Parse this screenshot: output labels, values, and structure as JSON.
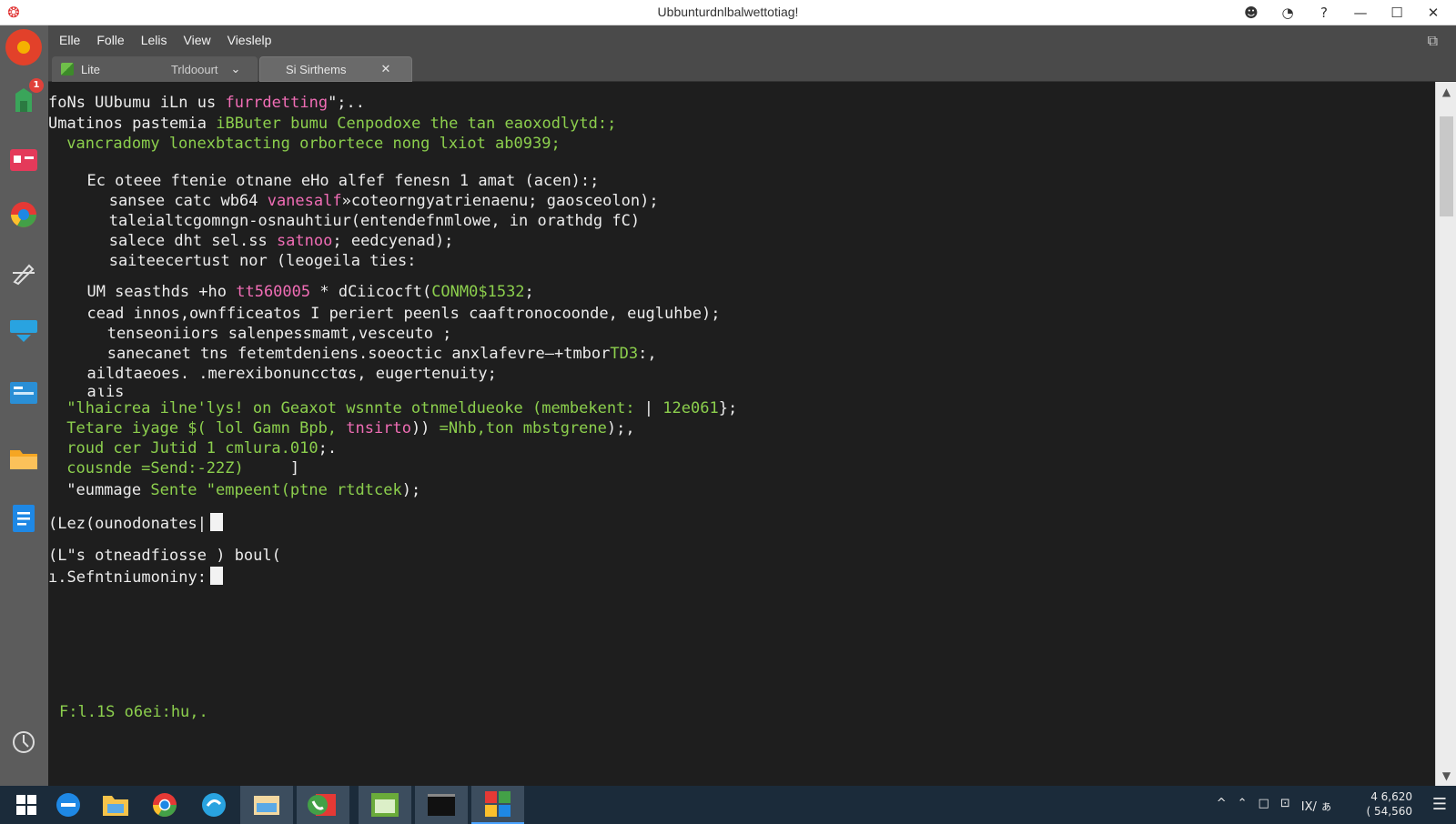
{
  "window": {
    "title": "Ubbunturdnlbalwettotiag!",
    "app_icon": "ubuntu-logo-icon"
  },
  "menu": [
    "Elle",
    "Folle",
    "Lelis",
    "View",
    "Vieslelp"
  ],
  "tabs": [
    {
      "label": "Lite",
      "sublabel": "Trldoourt",
      "icon": "cube-icon"
    },
    {
      "label": "Si Sirthems",
      "close": "✕"
    }
  ],
  "launcher": {
    "badge_count": "1"
  },
  "terminal": {
    "lines": [
      {
        "parts": [
          {
            "t": "foNs UUbumu iLn us ",
            "c": "w"
          },
          {
            "t": "furrdetting",
            "c": "p"
          },
          {
            "t": "\";..",
            "c": "w"
          }
        ]
      },
      {
        "parts": [
          {
            "t": "Umatinos pastemia ",
            "c": "w"
          },
          {
            "t": "iBButer bumu Cenpodoxe the tan eaoxodlytd:;",
            "c": "g"
          }
        ]
      },
      {
        "parts": [
          {
            "t": " vancradomy lonexbtacting orbortece nong lxiot ab0939;",
            "c": "g"
          }
        ]
      },
      {
        "parts": [
          {
            "t": "  Ec oteee ftenie otnane eHo alfef fenesn 1 amat (acen):;",
            "c": "w"
          }
        ]
      },
      {
        "parts": [
          {
            "t": "   sansee catc wb64 ",
            "c": "w"
          },
          {
            "t": "vanesalf",
            "c": "p"
          },
          {
            "t": "»coteorngyatrienaenu; gaosceolon);",
            "c": "w"
          }
        ]
      },
      {
        "parts": [
          {
            "t": "   taleialtcgomngn-osnauhtiur(entendefnmlowe, in orathdg fC)",
            "c": "w"
          }
        ]
      },
      {
        "parts": [
          {
            "t": "   salece dht sel.ss ",
            "c": "w"
          },
          {
            "t": "satnoo",
            "c": "p"
          },
          {
            "t": "; eedcyenad);",
            "c": "w"
          }
        ]
      },
      {
        "parts": [
          {
            "t": "   saiteecertust nor (leogeila ties:",
            "c": "w"
          }
        ]
      },
      {
        "parts": [
          {
            "t": "  UM seasthds +ho ",
            "c": "w"
          },
          {
            "t": "tt560005",
            "c": "p"
          },
          {
            "t": " * dCiicocft(",
            "c": "w"
          },
          {
            "t": "CONM0$1532",
            "c": "g"
          },
          {
            "t": ";",
            "c": "w"
          }
        ]
      },
      {
        "parts": [
          {
            "t": "  cead innos,ownfficeatos I periert peenls caaftronocoonde, eugluhbe);",
            "c": "w"
          }
        ]
      },
      {
        "parts": [
          {
            "t": "   tenseoniiors salenpessmamt,vesceuto ;",
            "c": "w"
          }
        ]
      },
      {
        "parts": [
          {
            "t": "   sanecanet tns fetemtdeniens.soeoctic anxlafevre—+tmbor",
            "c": "w"
          },
          {
            "t": "TD3",
            "c": "g"
          },
          {
            "t": ":,",
            "c": "w"
          }
        ]
      },
      {
        "parts": [
          {
            "t": "  aildtaeoes. .merexibonuncctαs, eugertenuity;",
            "c": "w"
          }
        ]
      },
      {
        "parts": [
          {
            "t": "  aιis",
            "c": "w"
          }
        ]
      },
      {
        "parts": [
          {
            "t": " \"lhaicrea ilne'lys! on Geaxot wsnnte otnmeldueoke (membekent:",
            "c": "g"
          },
          {
            "t": " | ",
            "c": "w"
          },
          {
            "t": "12e061",
            "c": "g"
          },
          {
            "t": "};",
            "c": "w"
          }
        ]
      },
      {
        "parts": [
          {
            "t": " Tetare iyage $( lol Gamn Bpb, ",
            "c": "g"
          },
          {
            "t": "tnsirto",
            "c": "p"
          },
          {
            "t": ")) ",
            "c": "w"
          },
          {
            "t": "=Nhb,ton mbstgrene",
            "c": "g"
          },
          {
            "t": ");,",
            "c": "w"
          }
        ]
      },
      {
        "parts": [
          {
            "t": " roud cer Jutid 1 cmlura.010",
            "c": "g"
          },
          {
            "t": ";.",
            "c": "w"
          }
        ]
      },
      {
        "parts": [
          {
            "t": " cousnde =Send:-22Z)",
            "c": "g"
          },
          {
            "t": "     ]",
            "c": "w"
          }
        ]
      },
      {
        "parts": [
          {
            "t": " \"eummage ",
            "c": "w"
          },
          {
            "t": "Sente \"empeent(ptne rtdtcek",
            "c": "g"
          },
          {
            "t": ");",
            "c": "w"
          }
        ]
      },
      {
        "parts": [
          {
            "t": "(Lez(ounodonates|",
            "c": "w"
          }
        ],
        "cursor": true
      },
      {
        "parts": [
          {
            "t": "(L\"s otneadfiosse ) boul(",
            "c": "w"
          }
        ]
      },
      {
        "parts": [
          {
            "t": "ı.Sefntniumoniny:",
            "c": "w"
          }
        ],
        "cursor": true
      }
    ],
    "status_line": "F:l.1S o6ei:hu,."
  },
  "tray": {
    "items": [
      "^",
      "⌃",
      "□",
      "⊡",
      "ΙΧ/ ぁ"
    ],
    "clock_time": "4 6,620",
    "clock_date": "( 54,560"
  },
  "colors": {
    "prompt_green": "#8ccf4d",
    "keyword_pink": "#f06db5",
    "bg": "#1e1e1e"
  }
}
